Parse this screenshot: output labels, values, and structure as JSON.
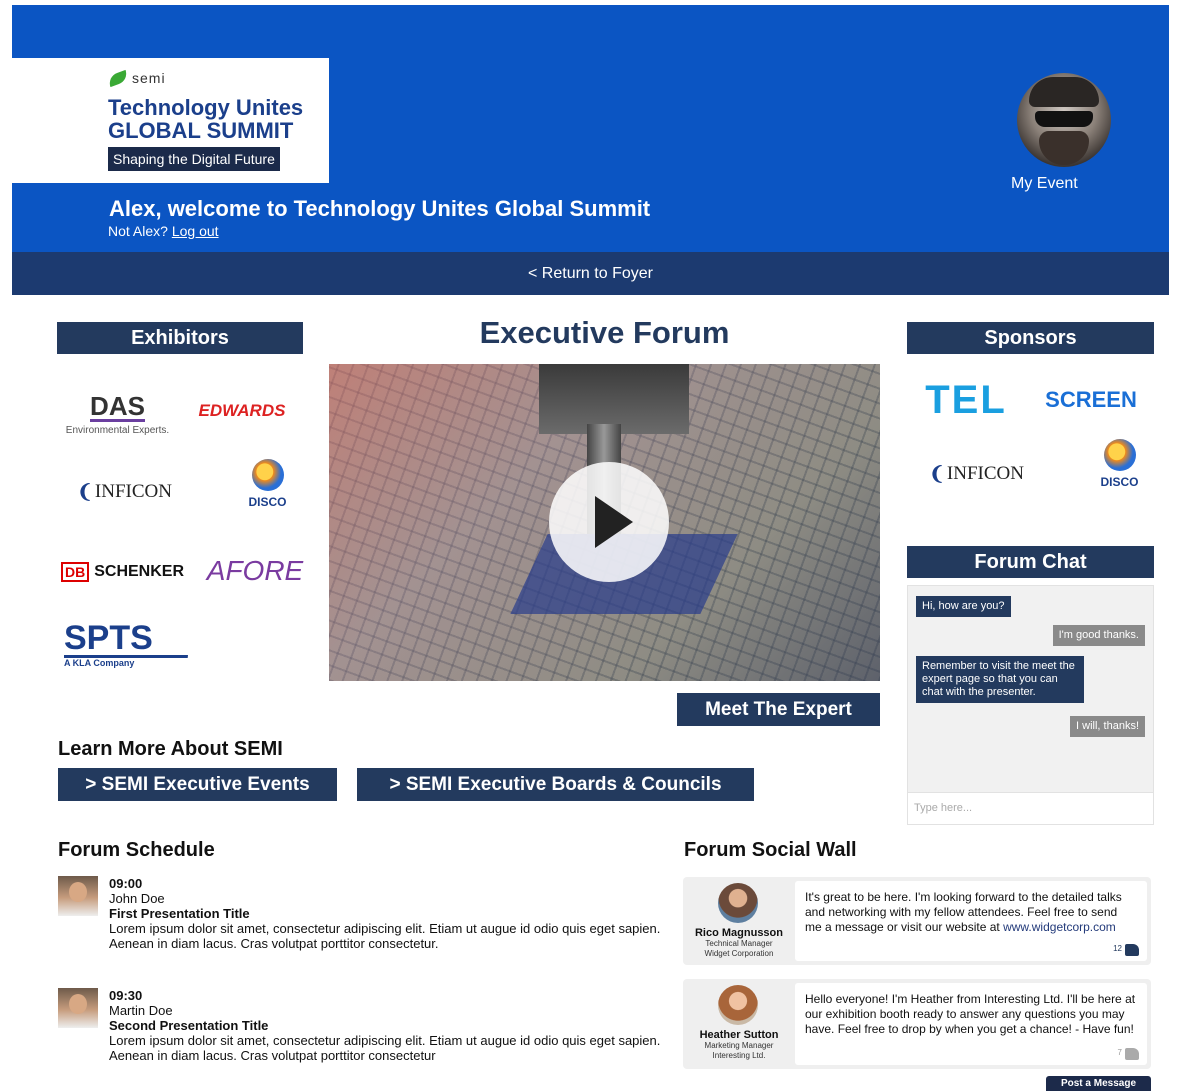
{
  "header": {
    "logo_brand": "semi",
    "logo_line1": "Technology Unites",
    "logo_line2": "GLOBAL SUMMIT",
    "logo_tagline": "Shaping the Digital Future",
    "welcome": "Alex, welcome to Technology Unites Global Summit",
    "not_user_prefix": "Not Alex?",
    "logout_label": "Log out",
    "my_event_label": "My Event",
    "return_label": "< Return to Foyer",
    "bg_color": "#0b55c3",
    "bar_color": "#1c3a70"
  },
  "exhibitors": {
    "heading": "Exhibitors",
    "logos": [
      {
        "name": "DAS",
        "sub": "Environmental Experts."
      },
      {
        "name": "EDWARDS"
      },
      {
        "name": "INFICON"
      },
      {
        "name": "DISCO"
      },
      {
        "name": "DB",
        "name2": "SCHENKER"
      },
      {
        "name": "AFORE"
      },
      {
        "name": "SPTS",
        "sub": "A KLA Company"
      }
    ]
  },
  "main": {
    "title": "Executive Forum",
    "video_play_icon": "play-icon",
    "meet_expert_label": "Meet The Expert"
  },
  "sponsors": {
    "heading": "Sponsors",
    "logos": [
      {
        "name": "TEL"
      },
      {
        "name": "SCREEN"
      },
      {
        "name": "INFICON"
      },
      {
        "name": "DISCO"
      }
    ]
  },
  "chat": {
    "heading": "Forum Chat",
    "messages": [
      {
        "from": "them",
        "text": "Hi, how are you?"
      },
      {
        "from": "me",
        "text": "I'm good thanks."
      },
      {
        "from": "them",
        "text": "Remember to visit the meet the expert page so that you can chat with the presenter."
      },
      {
        "from": "me",
        "text": "I will, thanks!"
      }
    ],
    "input_placeholder": "Type here..."
  },
  "learn_more": {
    "heading": "Learn More About SEMI",
    "links": [
      "> SEMI Executive Events",
      "> SEMI Executive Boards & Councils"
    ]
  },
  "schedule": {
    "heading": "Forum Schedule",
    "items": [
      {
        "time": "09:00",
        "speaker": "John Doe",
        "title": "First Presentation Title",
        "desc": "Lorem ipsum dolor sit amet, consectetur adipiscing elit. Etiam ut augue id odio quis eget sapien. Aenean in diam lacus. Cras volutpat porttitor consectetur."
      },
      {
        "time": "09:30",
        "speaker": "Martin Doe",
        "title": "Second Presentation Title",
        "desc": "Lorem ipsum dolor sit amet, consectetur adipiscing elit. Etiam ut augue id odio quis eget sapien. Aenean in diam lacus. Cras volutpat porttitor consectetur"
      }
    ]
  },
  "social_wall": {
    "heading": "Forum Social Wall",
    "posts": [
      {
        "name": "Rico Magnusson",
        "role": "Technical Manager",
        "company": "Widget Corporation",
        "text": "It's great to be here. I'm looking forward to the detailed talks and networking with my fellow attendees. Feel free to send me a message or visit our website at ",
        "link": "www.widgetcorp.com",
        "likes": "12"
      },
      {
        "name": "Heather Sutton",
        "role": "Marketing Manager",
        "company": "Interesting Ltd.",
        "text": "Hello everyone! I'm Heather from Interesting Ltd. I'll be here at our exhibition booth ready to answer any questions you may have. Feel free to drop by when you get a chance! - Have fun!",
        "likes": "7"
      }
    ],
    "post_button_label": "Post a Message"
  }
}
